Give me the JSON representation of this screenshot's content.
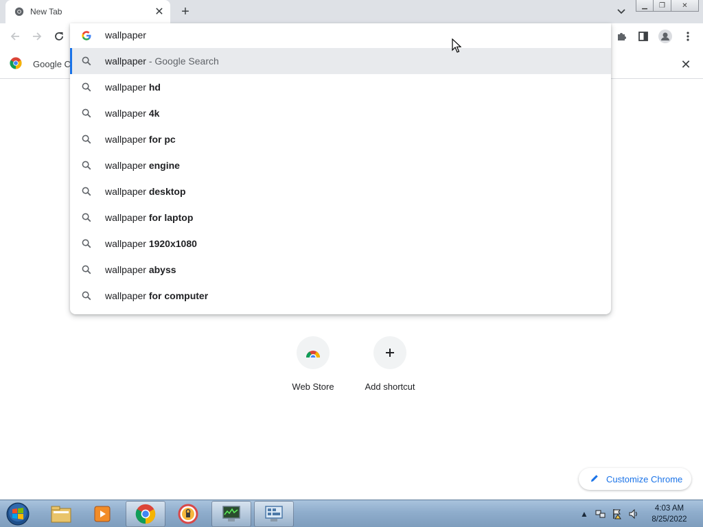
{
  "tab": {
    "title": "New Tab"
  },
  "omnibox": {
    "query": "wallpaper",
    "suggestions": [
      {
        "prefix": "wallpaper",
        "suffix": "",
        "dim": " - Google Search"
      },
      {
        "prefix": "wallpaper",
        "suffix": " hd",
        "dim": ""
      },
      {
        "prefix": "wallpaper",
        "suffix": " 4k",
        "dim": ""
      },
      {
        "prefix": "wallpaper",
        "suffix": " for pc",
        "dim": ""
      },
      {
        "prefix": "wallpaper",
        "suffix": " engine",
        "dim": ""
      },
      {
        "prefix": "wallpaper",
        "suffix": " desktop",
        "dim": ""
      },
      {
        "prefix": "wallpaper",
        "suffix": " for laptop",
        "dim": ""
      },
      {
        "prefix": "wallpaper",
        "suffix": " 1920x1080",
        "dim": ""
      },
      {
        "prefix": "wallpaper",
        "suffix": " abyss",
        "dim": ""
      },
      {
        "prefix": "wallpaper",
        "suffix": " for computer",
        "dim": ""
      }
    ]
  },
  "bookmarks": {
    "item_label": "Google C"
  },
  "shortcuts": [
    {
      "label": "Web Store",
      "icon": "chrome-web-store-icon"
    },
    {
      "label": "Add shortcut",
      "icon": "plus-icon"
    }
  ],
  "customize": {
    "label": "Customize Chrome"
  },
  "taskbar": {
    "apps": [
      "file-explorer-icon",
      "media-player-icon",
      "chrome-icon",
      "vpn-lock-icon",
      "task-manager-icon",
      "control-panel-icon"
    ],
    "clock": {
      "time": "4:03 AM",
      "date": "8/25/2022"
    }
  },
  "colors": {
    "accent": "#1a73e8",
    "tabstrip": "#dee1e6",
    "selected_row": "#e8eaed"
  }
}
